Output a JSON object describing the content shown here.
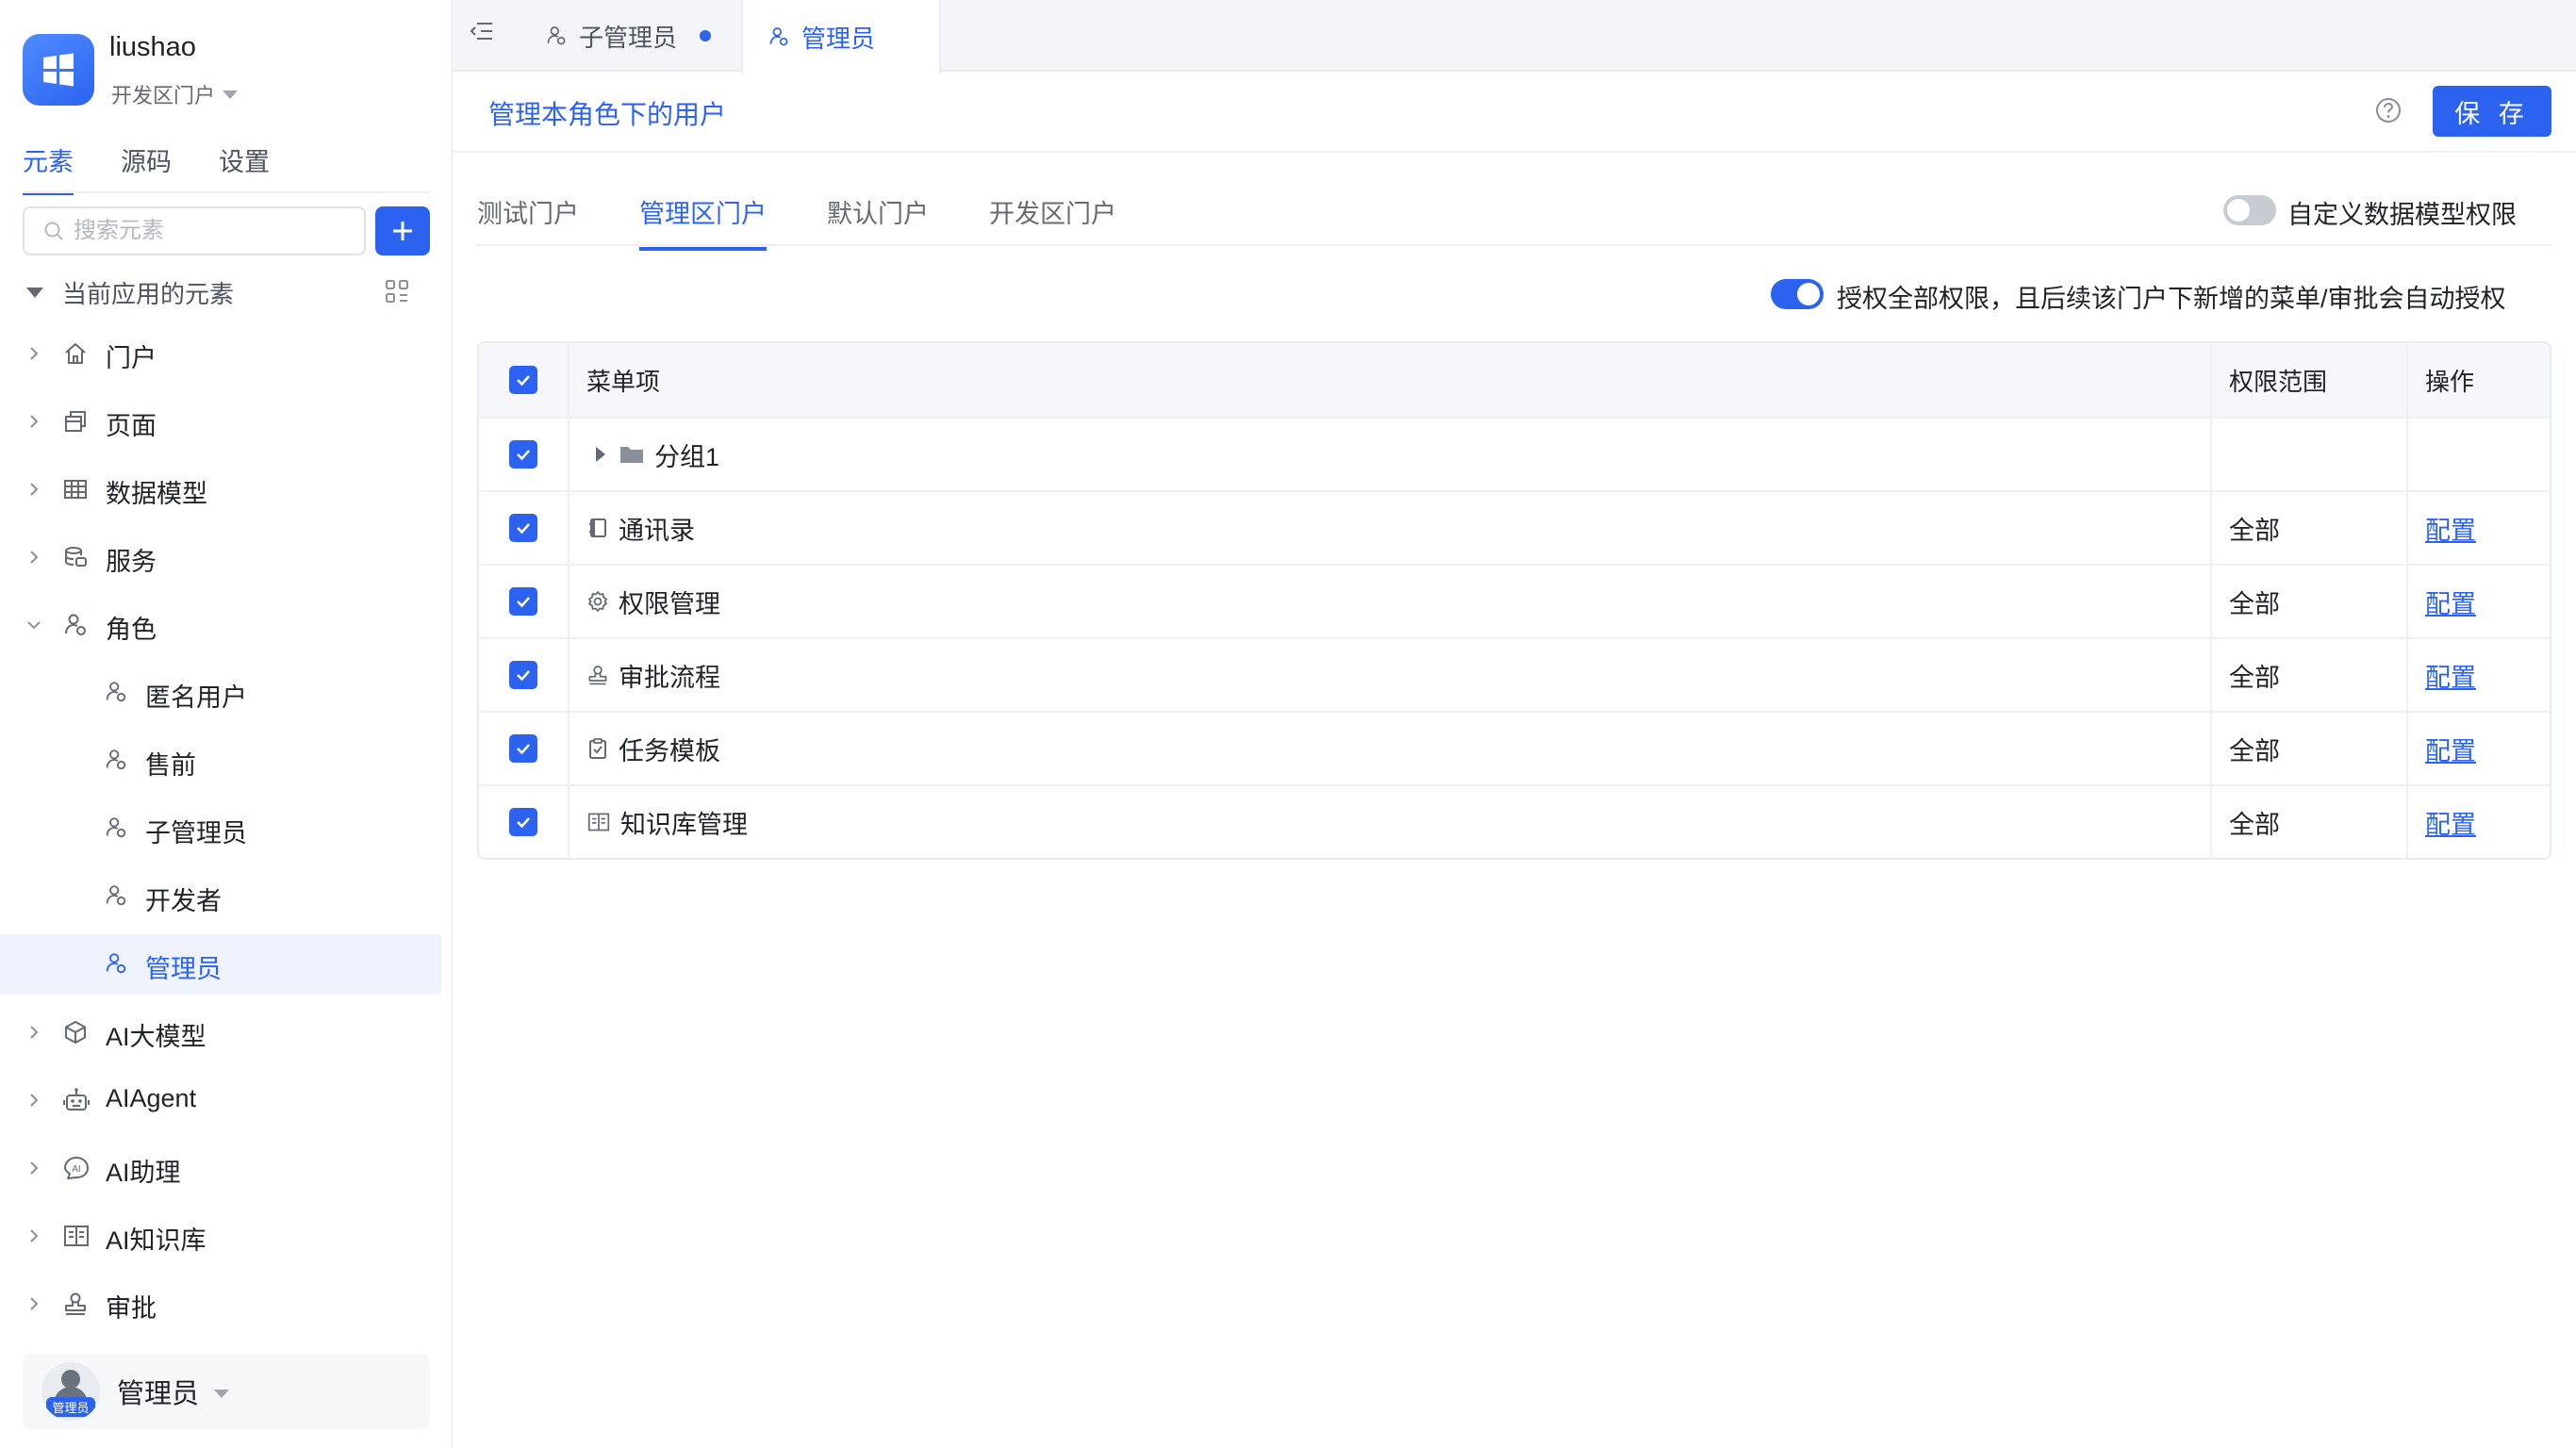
{
  "app": {
    "name": "liushao",
    "portal": "开发区门户"
  },
  "sidebar": {
    "tabs": [
      {
        "label": "元素",
        "active": true
      },
      {
        "label": "源码",
        "active": false
      },
      {
        "label": "设置",
        "active": false
      }
    ],
    "search_placeholder": "搜索元素",
    "tree_header": "当前应用的元素",
    "items": [
      {
        "label": "门户",
        "icon": "home-icon"
      },
      {
        "label": "页面",
        "icon": "page-icon"
      },
      {
        "label": "数据模型",
        "icon": "table-icon"
      },
      {
        "label": "服务",
        "icon": "database-icon"
      },
      {
        "label": "角色",
        "icon": "role-icon",
        "expanded": true
      },
      {
        "label": "AI大模型",
        "icon": "cube-icon"
      },
      {
        "label": "AIAgent",
        "icon": "robot-icon"
      },
      {
        "label": "AI助理",
        "icon": "ai-assistant-icon"
      },
      {
        "label": "AI知识库",
        "icon": "book-icon"
      },
      {
        "label": "审批",
        "icon": "stamp-icon"
      }
    ],
    "role_children": [
      {
        "label": "匿名用户"
      },
      {
        "label": "售前"
      },
      {
        "label": "子管理员"
      },
      {
        "label": "开发者"
      },
      {
        "label": "管理员",
        "selected": true
      }
    ],
    "user": {
      "name": "管理员",
      "badge": "管理员"
    }
  },
  "topbar": {
    "tabs": [
      {
        "label": "子管理员",
        "unsaved": true
      },
      {
        "label": "管理员",
        "active": true
      }
    ]
  },
  "content": {
    "title": "管理本角色下的用户",
    "save_label": "保 存",
    "portal_tabs": [
      {
        "label": "测试门户"
      },
      {
        "label": "管理区门户",
        "active": true
      },
      {
        "label": "默认门户"
      },
      {
        "label": "开发区门户"
      }
    ],
    "custom_model_toggle": {
      "label": "自定义数据模型权限",
      "on": false
    },
    "grant_all_toggle": {
      "label": "授权全部权限，且后续该门户下新增的菜单/审批会自动授权",
      "on": true
    },
    "table": {
      "headers": {
        "menu": "菜单项",
        "scope": "权限范围",
        "op": "操作"
      },
      "rows": [
        {
          "name": "分组1",
          "icon": "folder-icon",
          "scope": "",
          "op": "",
          "group": true
        },
        {
          "name": "通讯录",
          "icon": "contacts-icon",
          "scope": "全部",
          "op": "配置"
        },
        {
          "name": "权限管理",
          "icon": "gear-icon",
          "scope": "全部",
          "op": "配置"
        },
        {
          "name": "审批流程",
          "icon": "stamp-icon",
          "scope": "全部",
          "op": "配置"
        },
        {
          "name": "任务模板",
          "icon": "task-icon",
          "scope": "全部",
          "op": "配置"
        },
        {
          "name": "知识库管理",
          "icon": "book-icon",
          "scope": "全部",
          "op": "配置"
        }
      ]
    }
  },
  "colors": {
    "accent": "#2b63f0",
    "text": "#1f2329",
    "muted": "#646a73"
  }
}
